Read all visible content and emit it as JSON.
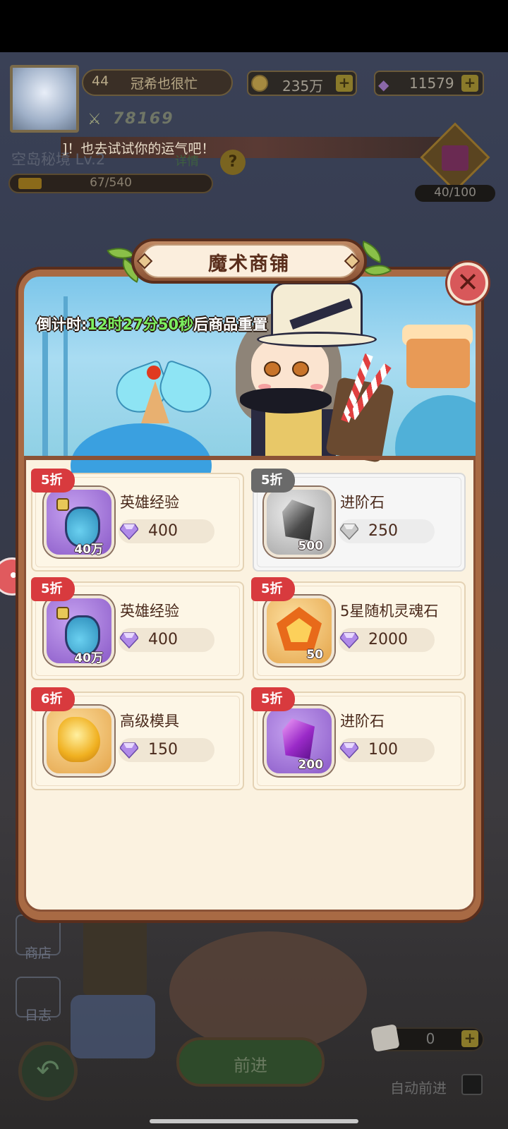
{
  "player": {
    "level": "44",
    "name": "冠希也很忙",
    "power": "78169",
    "coins": "235万",
    "gems": "11579"
  },
  "notice": "]！也去试试你的运气吧！",
  "stage": {
    "name": "空岛秘境 Lv.2",
    "detail_link": "详情",
    "help": "?",
    "progress_text": "67/540",
    "progress": 0.124
  },
  "gift": {
    "progress_text": "40/100",
    "progress": 0.4
  },
  "shop": {
    "title": "魔术商铺",
    "close_icon": "✕",
    "countdown_prefix": "倒计时:",
    "countdown_time": "12时27分50秒",
    "countdown_suffix": "后商品重置",
    "items": [
      {
        "discount": "5折",
        "name": "英雄经验",
        "qty": "40万",
        "price": "400",
        "icon": "exp-bottle-icon",
        "sold_out": false
      },
      {
        "discount": "5折",
        "name": "进阶石",
        "qty": "500",
        "price": "250",
        "icon": "grey-stone-icon",
        "sold_out": true
      },
      {
        "discount": "5折",
        "name": "英雄经验",
        "qty": "40万",
        "price": "400",
        "icon": "exp-bottle-icon",
        "sold_out": false
      },
      {
        "discount": "5折",
        "name": "5星随机灵魂石",
        "qty": "50",
        "price": "2000",
        "icon": "soul-stone-icon",
        "sold_out": false
      },
      {
        "discount": "6折",
        "name": "高级模具",
        "qty": "",
        "price": "150",
        "icon": "mold-icon",
        "sold_out": false
      },
      {
        "discount": "5折",
        "name": "进阶石",
        "qty": "200",
        "price": "100",
        "icon": "purple-stone-icon",
        "sold_out": false
      }
    ]
  },
  "menu": {
    "shop": "商店",
    "log": "日志"
  },
  "bottom": {
    "go": "前进",
    "dice_count": "0",
    "auto": "自动前进",
    "plus": "+"
  },
  "colors": {
    "discount_red": "#d83a3e",
    "timer_green": "#7cf060",
    "panel_brown": "#a86a44"
  }
}
